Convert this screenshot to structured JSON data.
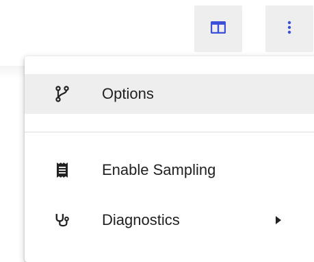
{
  "toolbar": {
    "columns_icon": "view-columns-icon",
    "more_icon": "more-vertical-icon",
    "accent_color": "#3b4fd8"
  },
  "menu": {
    "items": [
      {
        "label": "Options",
        "icon": "fork-icon"
      },
      {
        "label": "Enable Sampling",
        "icon": "receipt-icon"
      },
      {
        "label": "Diagnostics",
        "icon": "stethoscope-icon",
        "has_submenu": true
      }
    ]
  }
}
